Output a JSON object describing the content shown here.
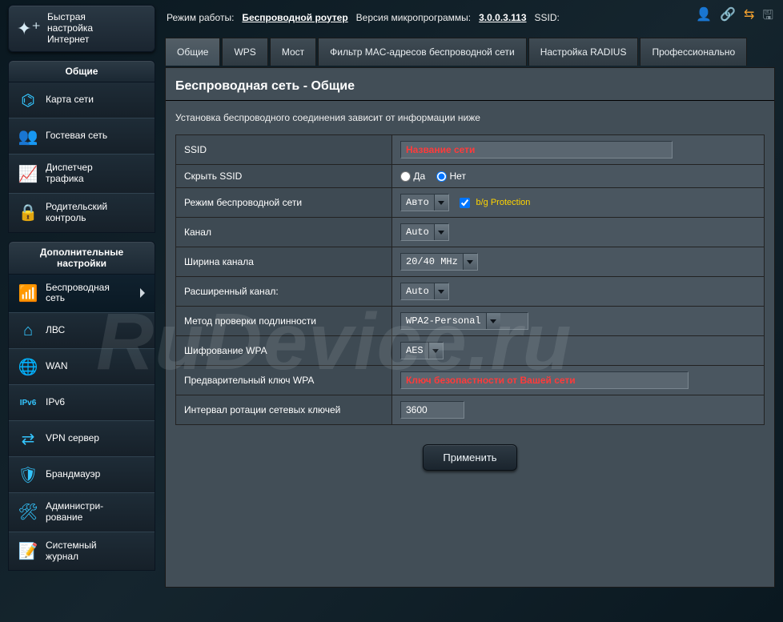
{
  "quick_setup": {
    "line1": "Быстрая",
    "line2": "настройка",
    "line3": "Интернет"
  },
  "sidebar": {
    "general_header": "Общие",
    "general": [
      {
        "icon": "network-map-icon",
        "glyph": "⌬",
        "label": "Карта сети"
      },
      {
        "icon": "guest-network-icon",
        "glyph": "👥",
        "label": "Гостевая сеть"
      },
      {
        "icon": "traffic-icon",
        "glyph": "📈",
        "label": "Диспетчер\nтрафика"
      },
      {
        "icon": "parental-icon",
        "glyph": "🔒",
        "label": "Родительский\nконтроль"
      }
    ],
    "advanced_header": "Дополнительные\nнастройки",
    "advanced": [
      {
        "icon": "wireless-icon",
        "glyph": "📶",
        "label": "Беспроводная\nсеть",
        "active": true
      },
      {
        "icon": "lan-icon",
        "glyph": "⌂",
        "label": "ЛВС"
      },
      {
        "icon": "wan-icon",
        "glyph": "🌐",
        "label": "WAN"
      },
      {
        "icon": "ipv6-icon",
        "glyph": "IPv6",
        "label": "IPv6"
      },
      {
        "icon": "vpn-icon",
        "glyph": "⇄",
        "label": "VPN сервер"
      },
      {
        "icon": "firewall-icon",
        "glyph": "🛡",
        "label": "Брандмауэр"
      },
      {
        "icon": "admin-icon",
        "glyph": "🛠",
        "label": "Администри-\nрование"
      },
      {
        "icon": "log-icon",
        "glyph": "📝",
        "label": "Системный\nжурнал"
      }
    ]
  },
  "topbar": {
    "mode_label": "Режим работы:",
    "mode_value": "Беспроводной роутер",
    "fw_label": "Версия микропрограммы:",
    "fw_value": "3.0.0.3.113",
    "ssid_label": "SSID:"
  },
  "tabs": [
    "Общие",
    "WPS",
    "Мост",
    "Фильтр MAC-адресов беспроводной сети",
    "Настройка RADIUS",
    "Профессионально"
  ],
  "panel": {
    "title": "Беспроводная сеть - Общие",
    "subtitle": "Установка беспроводного соединения зависит от информации ниже",
    "rows": {
      "ssid": "SSID",
      "hide_ssid": "Скрыть SSID",
      "wireless_mode": "Режим беспроводной сети",
      "channel": "Канал",
      "channel_width": "Ширина канала",
      "ext_channel": "Расширенный канал:",
      "auth": "Метод проверки подлинности",
      "wpa_enc": "Шифрование WPA",
      "wpa_key": "Предварительный ключ WPA",
      "rotation": "Интервал ротации сетевых ключей"
    },
    "values": {
      "ssid_placeholder": "Название сети",
      "hide_yes": "Да",
      "hide_no": "Нет",
      "wireless_mode": "Авто",
      "bg_protection": "b/g Protection",
      "channel": "Auto",
      "channel_width": "20/40 MHz",
      "ext_channel": "Auto",
      "auth": "WPA2-Personal",
      "wpa_enc": "AES",
      "wpa_key_placeholder": "Ключ безопастности от Вашей сети",
      "rotation": "3600"
    },
    "apply": "Применить"
  },
  "watermark": "RuDevice.ru"
}
